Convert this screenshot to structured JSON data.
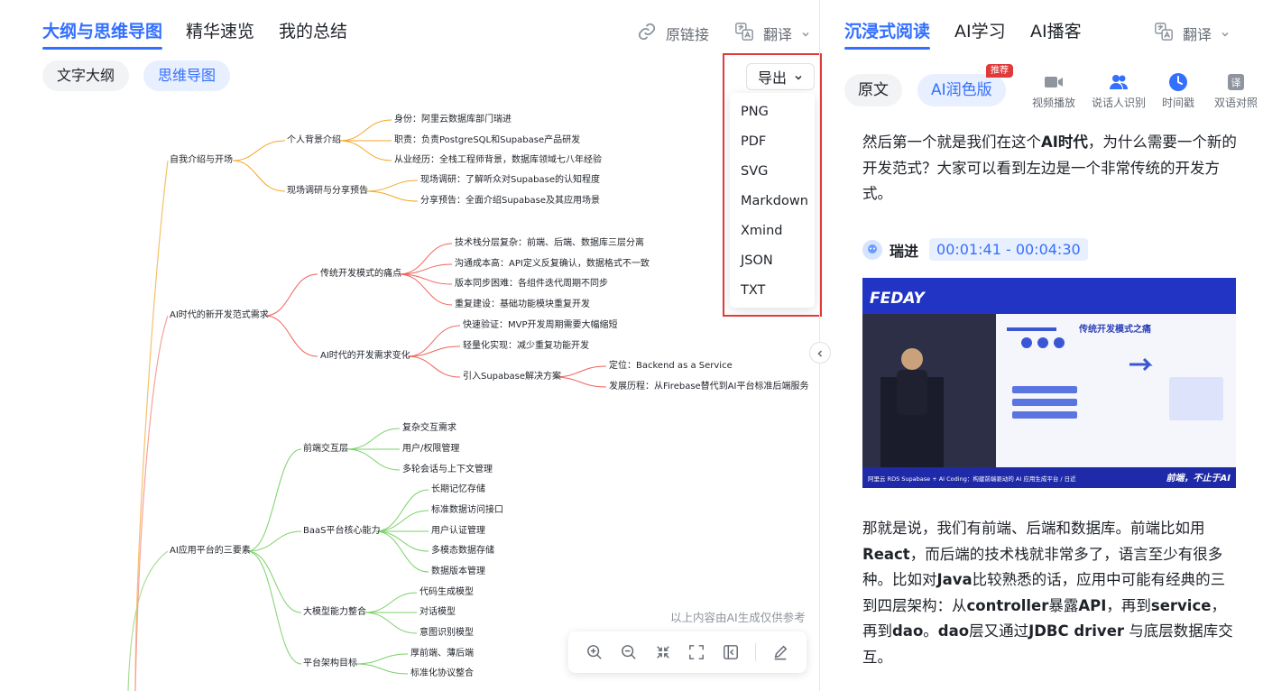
{
  "left": {
    "tabs": [
      {
        "label": "大纲与思维导图",
        "active": true
      },
      {
        "label": "精华速览",
        "active": false
      },
      {
        "label": "我的总结",
        "active": false
      }
    ],
    "original_link": "原链接",
    "translate": "翻译",
    "view_pills": [
      {
        "label": "文字大纲",
        "active": false
      },
      {
        "label": "思维导图",
        "active": true
      }
    ],
    "export": {
      "label": "导出",
      "options": [
        "PNG",
        "PDF",
        "SVG",
        "Markdown",
        "Xmind",
        "JSON",
        "TXT"
      ]
    },
    "disclaimer": "以上内容由AI生成仅供参考",
    "toolbar": [
      "zoom-in-icon",
      "zoom-out-icon",
      "fit-icon",
      "fullscreen-icon",
      "collapse-panel-icon",
      "edit-icon"
    ]
  },
  "mindmap": {
    "nodes": {
      "n1": "自我介绍与开场",
      "n1a": "个人背景介绍",
      "n1a1": "身份：阿里云数据库部门瑞进",
      "n1a2": "职责：负责PostgreSQL和Supabase产品研发",
      "n1a3": "从业经历：全栈工程师背景，数据库领域七八年经验",
      "n1b": "现场调研与分享预告",
      "n1b1": "现场调研：了解听众对Supabase的认知程度",
      "n1b2": "分享预告：全面介绍Supabase及其应用场景",
      "n2": "AI时代的新开发范式需求",
      "n2a": "传统开发模式的痛点",
      "n2a1": "技术栈分层复杂：前端、后端、数据库三层分离",
      "n2a2": "沟通成本高：API定义反复确认，数据格式不一致",
      "n2a3": "版本同步困难：各组件迭代周期不同步",
      "n2a4": "重复建设：基础功能模块重复开发",
      "n2b": "AI时代的开发需求变化",
      "n2b1": "快速验证：MVP开发周期需要大幅缩短",
      "n2b2": "轻量化实现：减少重复功能开发",
      "n2b3": "引入Supabase解决方案",
      "n2b3a": "定位：Backend as a Service",
      "n2b3b": "发展历程：从Firebase替代到AI平台标准后端服务",
      "n3": "AI应用平台的三要素",
      "n3a": "前端交互层",
      "n3a1": "复杂交互需求",
      "n3a2": "用户/权限管理",
      "n3a3": "多轮会话与上下文管理",
      "n3b": "BaaS平台核心能力",
      "n3b1": "长期记忆存储",
      "n3b2": "标准数据访问接口",
      "n3b3": "用户认证管理",
      "n3b4": "多模态数据存储",
      "n3b5": "数据版本管理",
      "n3c": "大模型能力整合",
      "n3c1": "代码生成模型",
      "n3c2": "对话模型",
      "n3c3": "意图识别模型",
      "n3d": "平台架构目标",
      "n3d1": "厚前端、薄后端",
      "n3d2": "标准化协议整合"
    },
    "colors": {
      "branch1": "#f5a623",
      "branch2": "#f0625b",
      "branch3": "#7bd16a",
      "trunk": "#f5c06b"
    }
  },
  "right": {
    "tabs": [
      {
        "label": "沉浸式阅读",
        "active": true
      },
      {
        "label": "AI学习",
        "active": false
      },
      {
        "label": "AI播客",
        "active": false
      }
    ],
    "translate": "翻译",
    "mode_pills": [
      {
        "label": "原文",
        "active": false
      },
      {
        "label": "AI润色版",
        "active": true
      }
    ],
    "new_badge": "推荐",
    "features": [
      {
        "label": "视频播放",
        "icon": "video-icon"
      },
      {
        "label": "说话人识别",
        "icon": "speaker-icon"
      },
      {
        "label": "时间戳",
        "icon": "clock-icon"
      },
      {
        "label": "双语对照",
        "icon": "translate-icon"
      }
    ],
    "para1": {
      "t1": "然后第一个就是我们在这个",
      "b1": "AI时代",
      "t2": "，为什么需要一个新的开发范式？大家可以看到左边是一个非常传统的开发方式。"
    },
    "speaker": {
      "name": "瑞进",
      "time": "00:01:41 - 00:04:30"
    },
    "video": {
      "logo": "FEDAY",
      "slide_title": "传统开发模式之痛",
      "caption": "阿里云 RDS Supabase + AI Coding：构建前端驱动的 AI 应用生成平台 / 日近",
      "slogan": "前端，不止于AI"
    },
    "para2": {
      "t1": "那就是说，我们有前端、后端和数据库。前端比如用 ",
      "b1": "React",
      "t2": "，而后端的技术栈就非常多了，语言至少有很多种。比如对",
      "b2": "Java",
      "t3": "比较熟悉的话，应用中可能有经典的三到四层架构：从",
      "b3": "controller",
      "t4": "暴露",
      "b4": "API",
      "t5": "，再到",
      "b5": "service",
      "t6": "，再到",
      "b6": "dao",
      "t7": "。",
      "b7": "dao",
      "t8": "层又通过",
      "b8": "JDBC driver",
      "t9": " 与底层数据库交互。"
    }
  }
}
